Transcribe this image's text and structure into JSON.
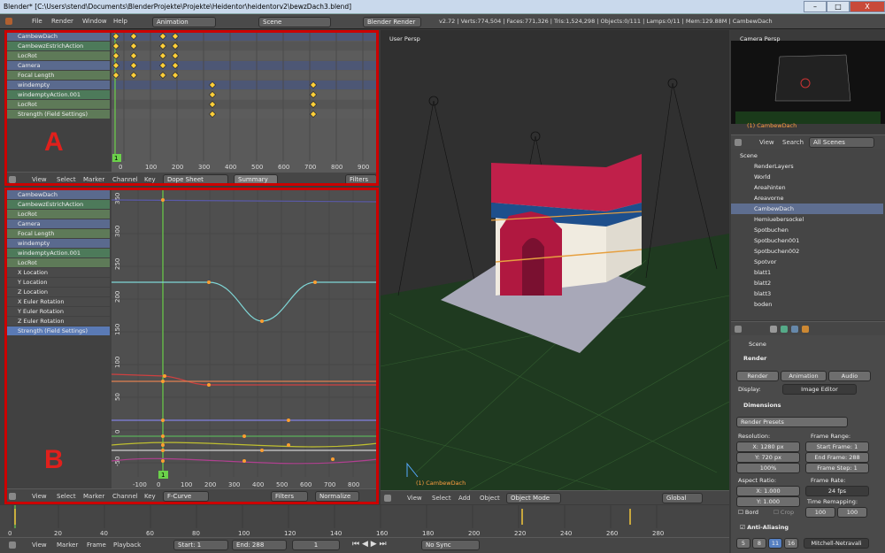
{
  "window": {
    "title": "Blender* [C:\\Users\\stend\\Documents\\BlenderProjekte\\Projekte\\Heidentor\\heidentorv2\\bewzDach3.blend]",
    "minimize": "–",
    "maximize": "□",
    "close": "X"
  },
  "info": {
    "menu": [
      "File",
      "Render",
      "Window",
      "Help"
    ],
    "layout": "Animation",
    "scene": "Scene",
    "engine": "Blender Render",
    "stats": "v2.72 | Verts:774,504 | Faces:771,326 | Tris:1,524,298 | Objects:0/111 | Lamps:0/11 | Mem:129.88M | CambewDach"
  },
  "dopesheet": {
    "letter": "A",
    "channels": [
      {
        "label": "CambewDach",
        "kind": "obj"
      },
      {
        "label": "CambewzEstrichAction",
        "kind": "act"
      },
      {
        "label": "LocRot",
        "kind": "sub"
      },
      {
        "label": "Camera",
        "kind": "obj"
      },
      {
        "label": "Focal Length",
        "kind": "sub"
      },
      {
        "label": "windempty",
        "kind": "obj"
      },
      {
        "label": "windemptyAction.001",
        "kind": "act"
      },
      {
        "label": "LocRot",
        "kind": "sub"
      },
      {
        "label": "Strength (Field Settings)",
        "kind": "sub"
      }
    ],
    "ticks": [
      "0",
      "100",
      "200",
      "300",
      "400",
      "500",
      "600",
      "700",
      "800",
      "900"
    ],
    "current_frame": "1",
    "header": {
      "menu": [
        "View",
        "Select",
        "Marker",
        "Channel",
        "Key"
      ],
      "mode": "Dope Sheet",
      "summary": "Summary",
      "filters": "Filters"
    }
  },
  "graph": {
    "letter": "B",
    "channels": [
      {
        "label": "CambewDach",
        "kind": "obj"
      },
      {
        "label": "CambewzEstrichAction",
        "kind": "act"
      },
      {
        "label": "LocRot",
        "kind": "sub"
      },
      {
        "label": "Camera",
        "kind": "obj"
      },
      {
        "label": "Focal Length",
        "kind": "sub"
      },
      {
        "label": "windempty",
        "kind": "obj"
      },
      {
        "label": "windemptyAction.001",
        "kind": "act"
      },
      {
        "label": "LocRot",
        "kind": "sub"
      },
      {
        "label": "X Location",
        "kind": "fcurve"
      },
      {
        "label": "Y Location",
        "kind": "fcurve"
      },
      {
        "label": "Z Location",
        "kind": "fcurve"
      },
      {
        "label": "X Euler Rotation",
        "kind": "fcurve"
      },
      {
        "label": "Y Euler Rotation",
        "kind": "fcurve"
      },
      {
        "label": "Z Euler Rotation",
        "kind": "fcurve"
      },
      {
        "label": "Strength (Field Settings)",
        "kind": "sel"
      }
    ],
    "yticks": [
      "350",
      "300",
      "250",
      "200",
      "150",
      "100",
      "50",
      "0",
      "-50"
    ],
    "xticks": [
      "-100",
      "0",
      "100",
      "200",
      "300",
      "400",
      "500",
      "600",
      "700",
      "800"
    ],
    "current_frame": "1",
    "header": {
      "menu": [
        "View",
        "Select",
        "Marker",
        "Channel",
        "Key"
      ],
      "mode": "F-Curve",
      "filters": "Filters",
      "normalize": "Normalize"
    }
  },
  "viewport": {
    "label": "User Persp",
    "object_label": "(1) CambewDach",
    "header": {
      "menu": [
        "View",
        "Select",
        "Add",
        "Object"
      ],
      "mode": "Object Mode",
      "orientation": "Global"
    }
  },
  "camera_view": {
    "label": "Camera Persp",
    "object_label": "(1) CambewDach"
  },
  "outliner": {
    "header": {
      "view": "View",
      "search": "Search",
      "filter": "All Scenes"
    },
    "items": [
      "Scene",
      "RenderLayers",
      "World",
      "Areahinten",
      "Areavorne",
      "CambewDach",
      "Hemiuebersockel",
      "Spotbuchen",
      "Spotbuchen001",
      "Spotbuchen002",
      "Spotvor",
      "blatt1",
      "blatt2",
      "blatt3",
      "boden"
    ]
  },
  "properties": {
    "context": "Scene",
    "render_section": "Render",
    "render_btn": "Render",
    "animation_btn": "Animation",
    "audio_btn": "Audio",
    "display_label": "Display:",
    "display_value": "Image Editor",
    "dimensions": "Dimensions",
    "presets": "Render Presets",
    "resolution": "Resolution:",
    "res_x": "X:",
    "res_x_val": "1280 px",
    "res_y": "Y:",
    "res_y_val": "720 px",
    "res_pct": "100%",
    "frame_range": "Frame Range:",
    "start_frame": "Start Frame:",
    "start_val": "1",
    "end_frame": "End Frame:",
    "end_val": "288",
    "frame_step": "Frame Step:",
    "step_val": "1",
    "aspect": "Aspect Ratio:",
    "asp_x": "X:",
    "asp_x_val": "1.000",
    "asp_y": "Y:",
    "asp_y_val": "1.000",
    "frame_rate": "Frame Rate:",
    "fps": "24 fps",
    "time_remap": "Time Remapping:",
    "remap_a": "100",
    "remap_b": "100",
    "bord": "Bord",
    "crop": "Crop",
    "aa": "Anti-Aliasing",
    "aa_samples": [
      "5",
      "8",
      "11",
      "16"
    ],
    "aa_filter": "Mitchell-Netravali"
  },
  "timeline": {
    "ticks": [
      "0",
      "20",
      "40",
      "60",
      "80",
      "100",
      "120",
      "140",
      "160",
      "180",
      "200",
      "220",
      "240",
      "260",
      "280"
    ],
    "menu": [
      "View",
      "Marker",
      "Frame",
      "Playback"
    ],
    "start": "Start:",
    "start_val": "1",
    "end": "End:",
    "end_val": "288",
    "current": "1",
    "sync": "No Sync"
  }
}
